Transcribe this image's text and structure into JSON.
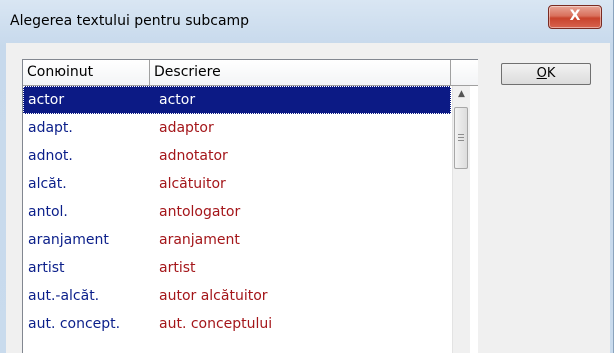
{
  "window": {
    "title": "Alegerea textului pentru subcamp",
    "close_glyph": "X"
  },
  "list": {
    "columns": [
      "Conюinut",
      "Descriere"
    ],
    "selected_index": 0,
    "rows": [
      {
        "content": "actor",
        "description": "actor"
      },
      {
        "content": "adapt.",
        "description": "adaptor"
      },
      {
        "content": "adnot.",
        "description": "adnotator"
      },
      {
        "content": "alcăt.",
        "description": "alcătuitor"
      },
      {
        "content": "antol.",
        "description": "antologator"
      },
      {
        "content": "aranjament",
        "description": "aranjament"
      },
      {
        "content": "artist",
        "description": "artist"
      },
      {
        "content": "aut.-alcăt.",
        "description": "autor alcătuitor"
      },
      {
        "content": "aut. concept.",
        "description": "aut. conceptului"
      }
    ]
  },
  "buttons": {
    "ok_accel": "O",
    "ok_rest": "K"
  },
  "colors": {
    "content_text": "#0b1f8a",
    "description_text": "#a4161a",
    "selection": "#0c1a85"
  }
}
